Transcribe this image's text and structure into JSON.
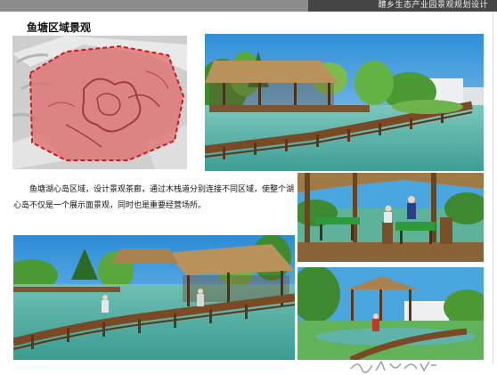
{
  "header": {
    "title": "醴乡生态产业园景观规划设计"
  },
  "section": {
    "title": "鱼塘区域景观"
  },
  "description": {
    "text": "鱼塘湖心岛区域，设计景观茶廊，通过木栈道分别连接不同区域，使整个湖心岛不仅是一个展示面景观，同时也是重要经营场所。"
  },
  "colors": {
    "header_bar": "#454545",
    "header_bar_light": "#8c8c8c",
    "water": "#5fb3a8",
    "sky": "#3fa1e0",
    "highlight_zone": "#e06a6a"
  }
}
